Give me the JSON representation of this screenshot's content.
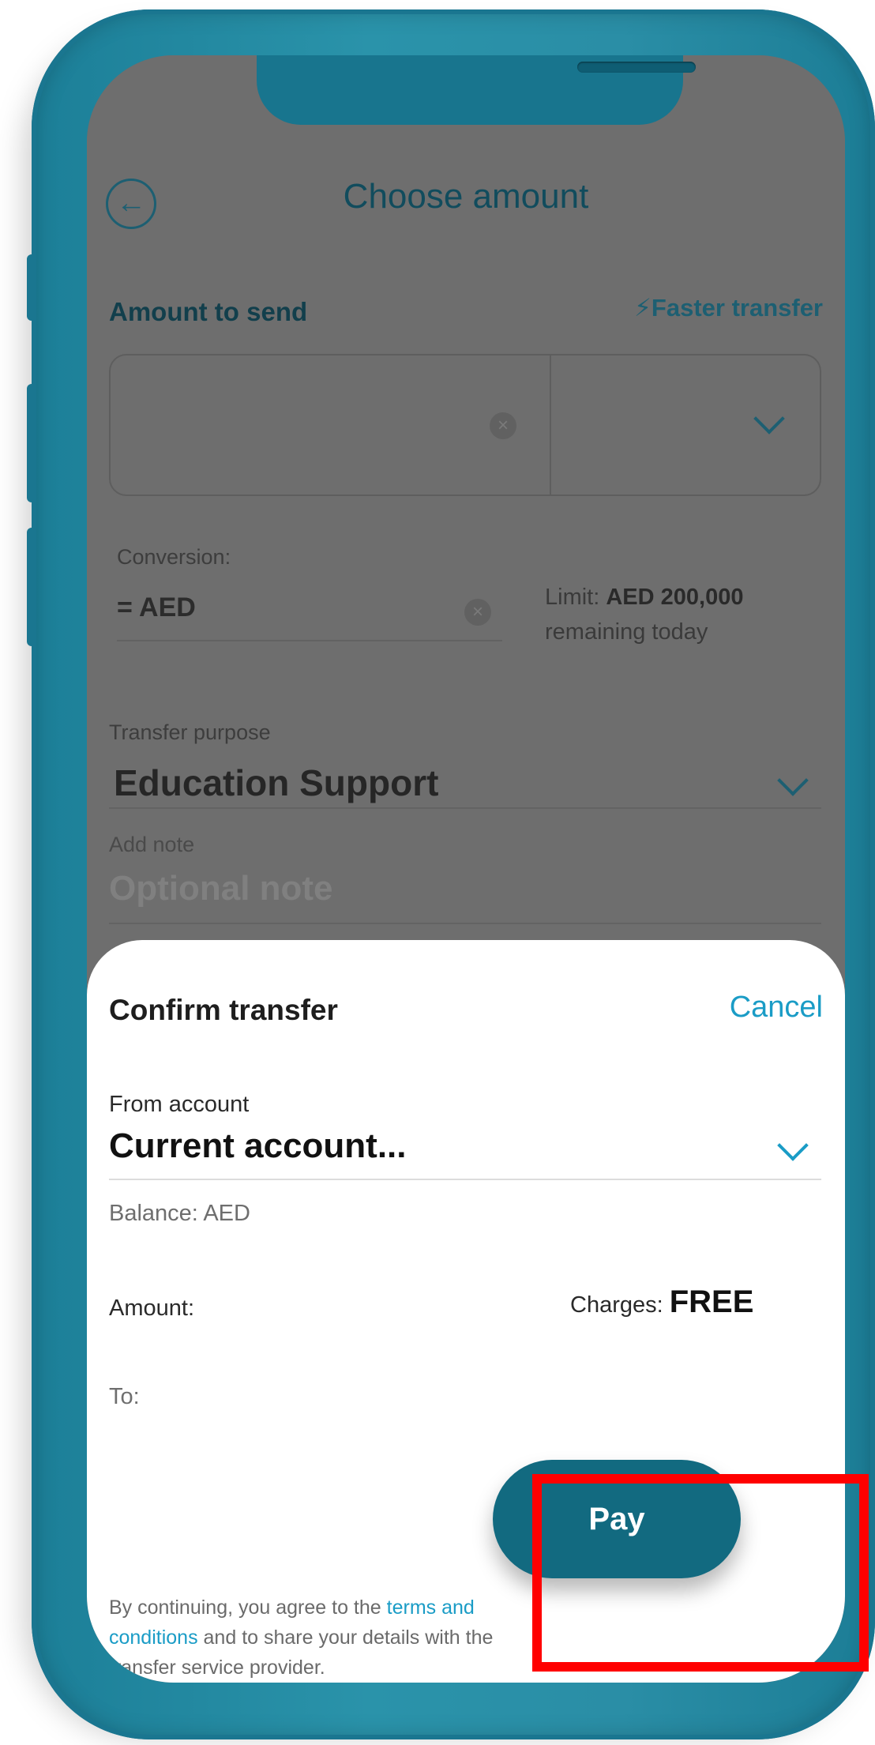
{
  "header": {
    "title": "Choose amount"
  },
  "amount_section": {
    "label": "Amount to send",
    "faster_transfer": "Faster transfer",
    "faster_icon": "⚡"
  },
  "conversion": {
    "label": "Conversion:",
    "value": "= AED",
    "limit_prefix": "Limit:",
    "limit_amount": "AED 200,000",
    "limit_suffix": "remaining today"
  },
  "transfer_purpose": {
    "label": "Transfer purpose",
    "value": "Education Support"
  },
  "note": {
    "label": "Add note",
    "placeholder": "Optional note"
  },
  "confirm_sheet": {
    "title": "Confirm transfer",
    "cancel_label": "Cancel",
    "from_account_label": "From account",
    "from_account_value": "Current account...",
    "balance": "Balance: AED",
    "amount_label": "Amount:",
    "charges_label": "Charges:",
    "charges_value": "FREE",
    "to_label": "To:",
    "legal_prefix": "By continuing, you agree to the",
    "legal_link": "terms and conditions",
    "legal_suffix": "and to share your details with the transfer service provider.",
    "pay_label": "Pay"
  },
  "colors": {
    "brand_teal": "#126a80",
    "link_blue": "#1a9cc6",
    "highlight_red": "#ff0000"
  },
  "icons": {
    "back": "back-arrow-circle-icon",
    "clear": "clear-x-circle-icon",
    "dropdown": "chevron-down-icon",
    "faster": "lightning-bolt-icon"
  }
}
